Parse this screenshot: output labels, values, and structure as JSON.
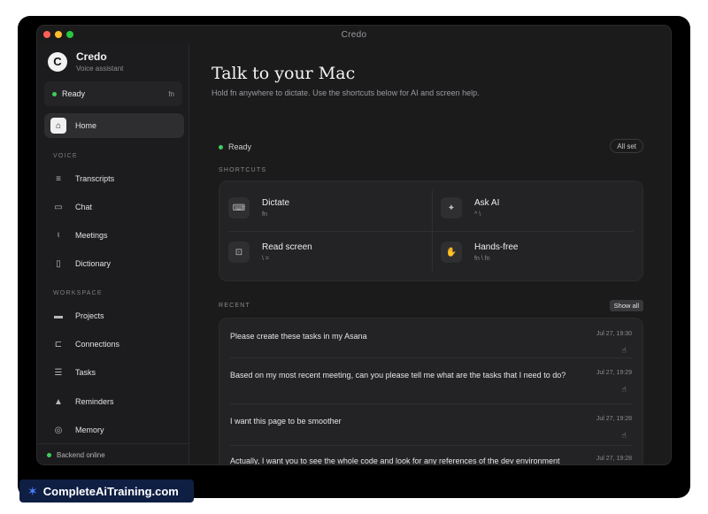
{
  "window": {
    "title": "Credo"
  },
  "sidebar": {
    "brand": {
      "name": "Credo",
      "subtitle": "Voice assistant",
      "logo_icon": "credo-logo-icon"
    },
    "status": {
      "label": "Ready",
      "key": "fn"
    },
    "home": {
      "label": "Home",
      "icon": "home-icon"
    },
    "voice_section": "VOICE",
    "voice_items": [
      {
        "label": "Transcripts",
        "icon": "transcript-icon"
      },
      {
        "label": "Chat",
        "icon": "chat-icon"
      },
      {
        "label": "Meetings",
        "icon": "microphone-icon"
      },
      {
        "label": "Dictionary",
        "icon": "book-icon"
      }
    ],
    "workspace_section": "WORKSPACE",
    "workspace_items": [
      {
        "label": "Projects",
        "icon": "folder-icon"
      },
      {
        "label": "Connections",
        "icon": "plug-icon"
      },
      {
        "label": "Tasks",
        "icon": "checklist-icon"
      },
      {
        "label": "Reminders",
        "icon": "bell-icon"
      },
      {
        "label": "Memory",
        "icon": "brain-icon"
      }
    ],
    "backend_status": "Backend online"
  },
  "main": {
    "title": "Talk to your Mac",
    "subtitle": "Hold fn anywhere to dictate. Use the shortcuts below for AI and screen help.",
    "status": "Ready",
    "all_set": "All set",
    "shortcuts_title": "SHORTCUTS",
    "shortcuts": [
      {
        "label": "Dictate",
        "key": "fn",
        "icon": "keyboard-icon"
      },
      {
        "label": "Ask AI",
        "key": "^ \\",
        "icon": "sparkle-icon"
      },
      {
        "label": "Read screen",
        "key": "\\ =",
        "icon": "scan-icon"
      },
      {
        "label": "Hands-free",
        "key": "fn \\ fn",
        "icon": "hand-icon"
      }
    ],
    "recent_title": "RECENT",
    "show_all": "Show all",
    "recent": [
      {
        "text": "Please create these tasks in my Asana",
        "time": "Jul 27, 19:30"
      },
      {
        "text": "Based on my most recent meeting, can you please tell me what are the tasks that I need to do?",
        "time": "Jul 27, 19:29"
      },
      {
        "text": "I want this page to be smoother",
        "time": "Jul 27, 19:28"
      },
      {
        "text": "Actually, I want you to see the whole code and look for any references of the dev environment",
        "time": "Jul 27, 19:28"
      }
    ]
  },
  "badge": {
    "text": "CompleteAiTraining.com"
  },
  "colors": {
    "accent_green": "#3ecf5a",
    "window_bg": "#1b1b1c",
    "badge_bg": "#0f1f44"
  }
}
